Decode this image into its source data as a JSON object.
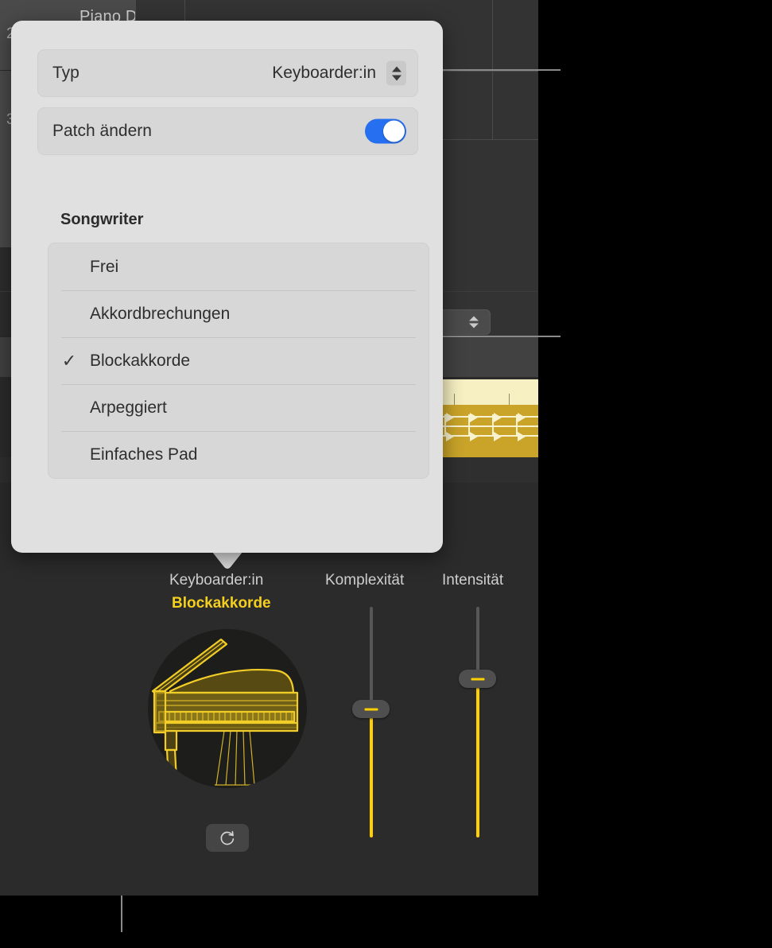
{
  "background": {
    "track_name": "Piano Dicht",
    "track_numbers": [
      "2",
      "3"
    ],
    "region_color": "#c9a429",
    "stepper_icon": "up-down-stepper-icon"
  },
  "popover": {
    "type_row": {
      "label": "Typ",
      "value": "Keyboarder:in",
      "stepper_icon": "up-down-stepper-icon"
    },
    "patch_row": {
      "label": "Patch ändern",
      "toggle_state": "on",
      "toggle_color": "#266ff0"
    },
    "group_title": "Songwriter",
    "menu_items": [
      {
        "label": "Frei",
        "checked": ""
      },
      {
        "label": "Akkordbrechungen",
        "checked": ""
      },
      {
        "label": "Blockakkorde",
        "checked": "✓"
      },
      {
        "label": "Arpeggiert",
        "checked": ""
      },
      {
        "label": "Einfaches Pad",
        "checked": ""
      }
    ]
  },
  "controls": {
    "performer_label": "Keyboarder:in",
    "performer_value": "Blockakkorde",
    "performer_value_color": "#f4cf1e",
    "instrument_icon": "grand-piano-icon",
    "refresh_icon": "refresh-icon",
    "sliders": [
      {
        "label": "Komplexität",
        "value_pct": 56
      },
      {
        "label": "Intensität",
        "value_pct": 69
      }
    ]
  }
}
